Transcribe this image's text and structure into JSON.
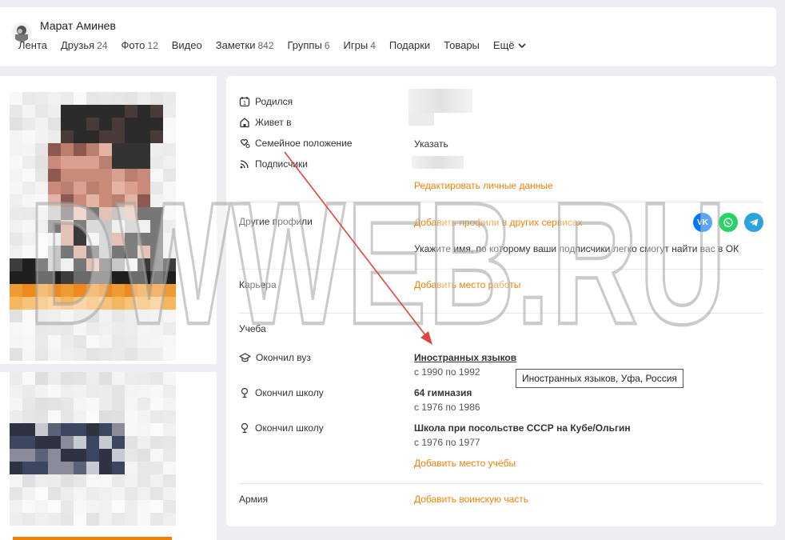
{
  "header": {
    "user_name": "Марат Аминев",
    "nav": [
      {
        "label": "Лента",
        "count": ""
      },
      {
        "label": "Друзья",
        "count": "24"
      },
      {
        "label": "Фото",
        "count": "12"
      },
      {
        "label": "Видео",
        "count": ""
      },
      {
        "label": "Заметки",
        "count": "842"
      },
      {
        "label": "Группы",
        "count": "6"
      },
      {
        "label": "Игры",
        "count": "4"
      },
      {
        "label": "Подарки",
        "count": ""
      },
      {
        "label": "Товары",
        "count": ""
      }
    ],
    "more_label": "Ещё"
  },
  "personal": {
    "born_label": "Родился",
    "lives_label": "Живет в",
    "family_label": "Семейное положение",
    "family_value": "Указать",
    "subscribers_label": "Подписчики",
    "edit_link": "Редактировать личные данные"
  },
  "other_profiles": {
    "label": "Другие профили",
    "add_link": "Добавить профили в других сервисах",
    "hint": "Укажите имя, по которому ваши подписчики легко смогут найти вас в ОК",
    "icons": [
      "vk-icon",
      "whatsapp-icon",
      "telegram-icon"
    ],
    "vk_text": "VK"
  },
  "career": {
    "label": "Карьера",
    "add_link": "Добавить место работы"
  },
  "education": {
    "label": "Учеба",
    "entries": [
      {
        "label": "Окончил вуз",
        "name": "Иностранных языков",
        "years": "с 1990 по 1992",
        "icon": "graduation-cap-icon"
      },
      {
        "label": "Окончил школу",
        "name": "64 гимназия",
        "years": "с 1976 по 1986",
        "icon": "school-icon"
      },
      {
        "label": "Окончил школу",
        "name": "Школа при посольстве СССР на Кубе/Ольгин",
        "years": "с 1976 по 1977",
        "icon": "school-icon"
      }
    ],
    "add_link": "Добавить место учёбы",
    "tooltip": "Иностранных языков, Уфа, Россия"
  },
  "army": {
    "label": "Армия",
    "add_link": "Добавить воинскую часть"
  },
  "watermark": "DWWEB.RU",
  "colors": {
    "accent": "#ee8208",
    "vk": "#0077ff",
    "whatsapp": "#25d366",
    "telegram": "#2aa3df",
    "arrow": "#e0473c"
  }
}
